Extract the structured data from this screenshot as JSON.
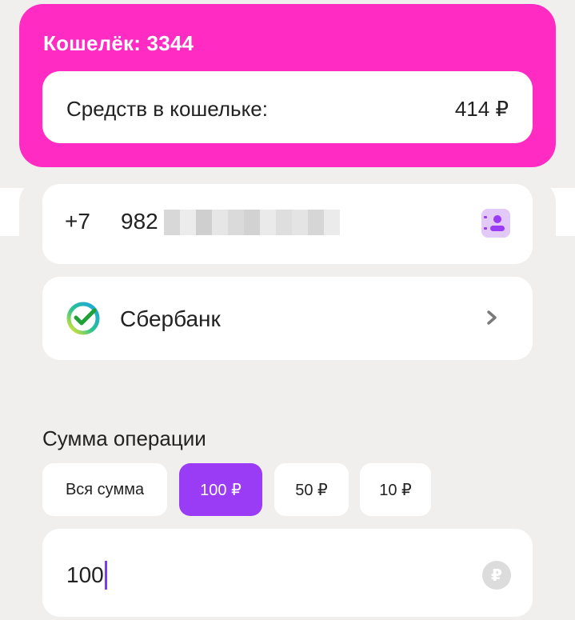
{
  "wallet": {
    "title": "Кошелёк: 3344",
    "balance_label": "Средств в кошельке:",
    "balance_value": "414 ₽",
    "color": "#ff2bc2"
  },
  "recipient": {
    "phone_code": "+7",
    "phone_prefix": "982",
    "contact_icon": "contact-book-icon"
  },
  "bank": {
    "name": "Сбербанк",
    "logo_icon": "sberbank-logo-icon",
    "chevron_icon": "chevron-right-icon"
  },
  "amount": {
    "title": "Сумма операции",
    "chips": [
      {
        "label": "Вся сумма",
        "active": false
      },
      {
        "label": "100 ₽",
        "active": true
      },
      {
        "label": "50 ₽",
        "active": false
      },
      {
        "label": "10 ₽",
        "active": false
      }
    ],
    "input_value": "100",
    "currency_symbol": "₽",
    "accent_color": "#9a3cf5"
  }
}
